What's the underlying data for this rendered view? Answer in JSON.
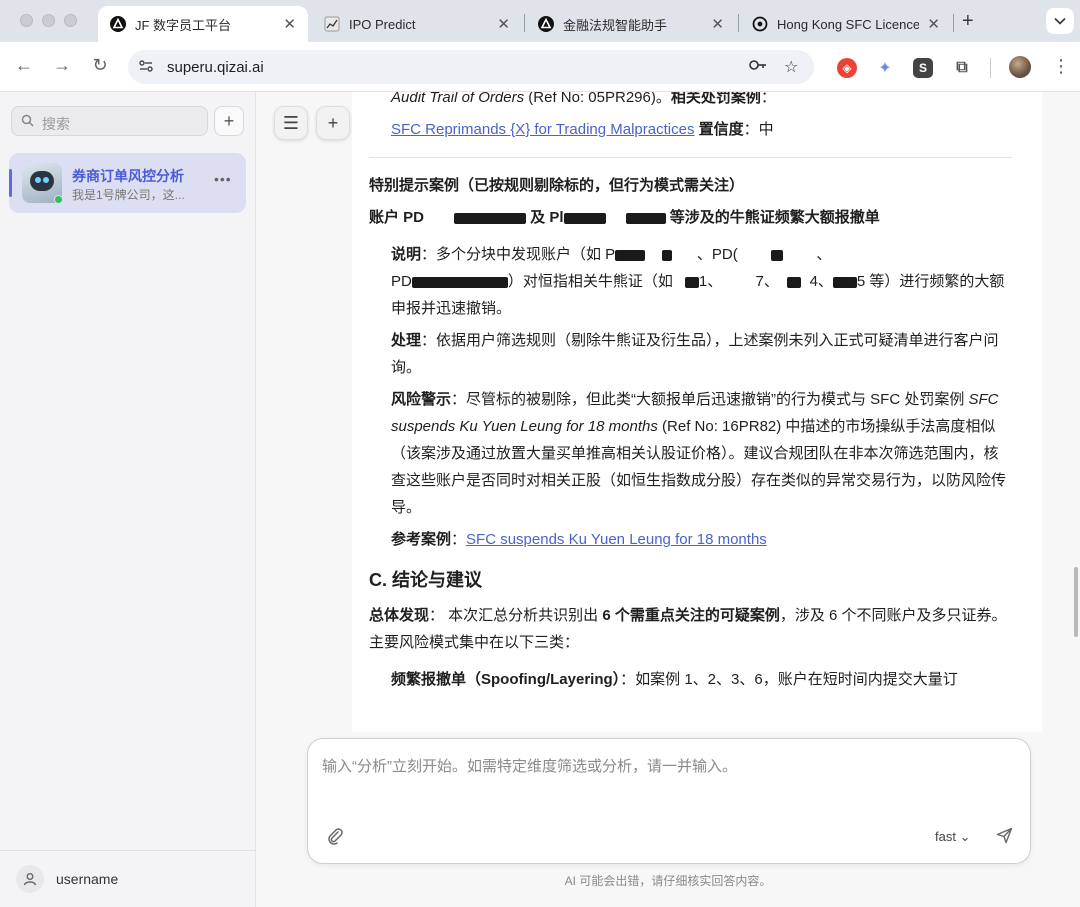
{
  "browser": {
    "tabs": [
      {
        "label": "JF 数字员工平台"
      },
      {
        "label": "IPO Predict"
      },
      {
        "label": "金融法规智能助手"
      },
      {
        "label": "Hong Kong SFC Licence"
      }
    ],
    "url": "superu.qizai.ai"
  },
  "sidebar": {
    "search_placeholder": "搜索",
    "chat": {
      "title": "券商订单风控分析",
      "subtitle": "我是1号牌公司，这..."
    },
    "user": {
      "name": "username"
    }
  },
  "content": {
    "top_line_italic": "Audit Trail of Orders",
    "top_line_ref": " (Ref No: 05PR296)。",
    "top_line_bold": "相关处罚案例",
    "top_line_tail": "：",
    "case_link_1": "SFC Reprimands {X} for Trading Malpractices",
    "confidence_label": "置信度",
    "confidence_value": "：中",
    "special_heading": "特别提示案例（已按规则剔除标的，但行为模式需关注）",
    "account_line_a": "账户 PD",
    "account_line_b": " 及 Pl",
    "account_line_c": " 等涉及的牛熊证频繁大额报撤单",
    "desc_label": "说明",
    "desc_a": "：多个分块中发现账户（如 P",
    "desc_b": "、PD(",
    "desc_c": "、",
    "desc_d": "PD",
    "desc_e": "）对恒指相关牛熊证（如",
    "desc_f": "1、",
    "desc_g": "7、",
    "desc_h": "4、",
    "desc_i": "5 等）进行频繁的大额申报并迅速撤销。",
    "handle_label": "处理",
    "handle_text": "：依据用户筛选规则（剔除牛熊证及衍生品），上述案例未列入正式可疑清单进行客户问询。",
    "risk_label": "风险警示",
    "risk_a": "：尽管标的被剔除，但此类“大额报单后迅速撤销”的行为模式与 SFC 处罚案例 ",
    "risk_italic": "SFC suspends Ku Yuen Leung for 18 months",
    "risk_b": " (Ref No: 16PR82) 中描述的市场操纵手法高度相似（该案涉及通过放置大量买单推高相关认股证价格）。建议合规团队在非本次筛选范围内，核查这些账户是否同时对相关正股（如恒生指数成分股）存在类似的异常交易行为，以防风险传导。",
    "ref_label": "参考案例",
    "ref_sep": "：",
    "ref_link": "SFC suspends Ku Yuen Leung for 18 months",
    "section_c": "C. 结论与建议",
    "summary_label": "总体发现",
    "summary_a": "： 本次汇总分析共识别出 ",
    "summary_bold": "6 个需重点关注的可疑案例",
    "summary_b": "，涉及 6 个不同账户及多只证券。主要风险模式集中在以下三类：",
    "spoof_label": "频繁报撤单（Spoofing/Layering）",
    "spoof_text": "：如案例 1、2、3、6，账户在短时间内提交大量订"
  },
  "composer": {
    "placeholder": "输入“分析”立刻开始。如需特定维度筛选或分析，请一并输入。",
    "model": "fast ⌄",
    "disclaimer": "AI 可能会出错，请仔细核实回答内容。"
  }
}
